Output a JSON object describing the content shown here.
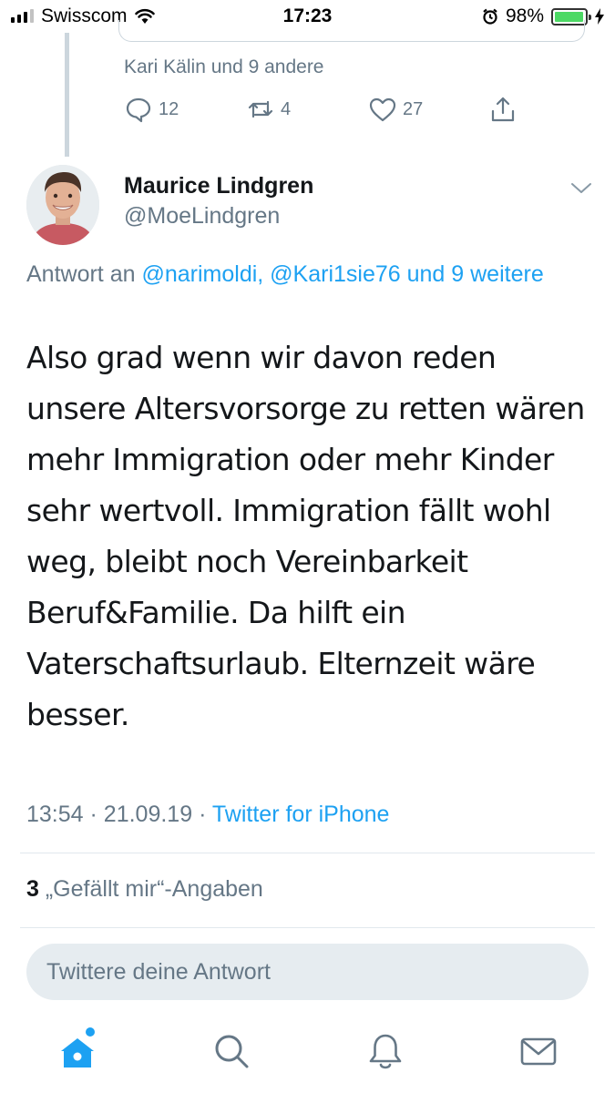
{
  "status_bar": {
    "carrier": "Swisscom",
    "time": "17:23",
    "battery_percent": "98%",
    "battery_level": 0.98,
    "icons": [
      "signal-bars-icon",
      "wifi-icon",
      "alarm-clock-icon",
      "battery-icon",
      "charging-bolt-icon"
    ]
  },
  "previous_tweet": {
    "liked_by": "Kari Kälin und 9 andere",
    "actions": {
      "reply_count": "12",
      "retweet_count": "4",
      "like_count": "27"
    }
  },
  "tweet": {
    "author_name": "Maurice Lindgren",
    "author_handle": "@MoeLindgren",
    "reply_prefix": "Antwort an",
    "reply_mentions": "@narimoldi, @Kari1sie76 und 9 weitere",
    "text": "Also grad wenn wir davon reden unsere Altersvorsorge zu retten wären mehr Immigration oder mehr Kinder sehr wertvoll. Immigration fällt wohl weg, bleibt noch Vereinbarkeit Beruf&Familie. Da hilft ein Vaterschaftsurlaub. Elternzeit wäre besser.",
    "time": "13:54",
    "date": "21.09.19",
    "source": "Twitter for iPhone",
    "likes_count": "3",
    "likes_label": "„Gefällt mir“-Angaben"
  },
  "reply": {
    "placeholder": "Twittere deine Antwort"
  },
  "colors": {
    "accent": "#1da1f2",
    "secondary_text": "#657786",
    "primary_text": "#14171a",
    "reply_field_bg": "#e6ecf0"
  }
}
